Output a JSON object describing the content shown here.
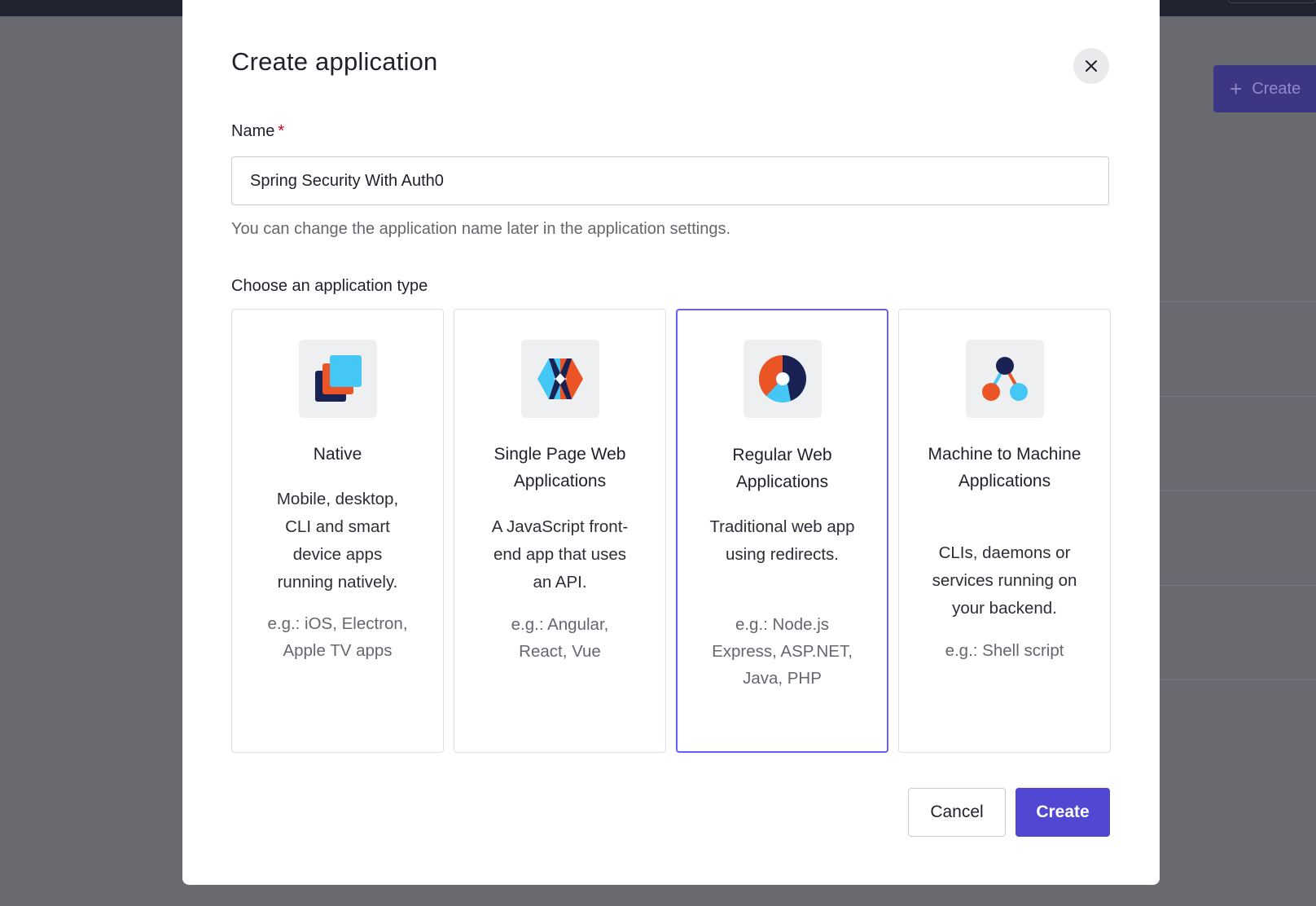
{
  "background": {
    "create_button_label": "Create"
  },
  "modal": {
    "title": "Create application",
    "name_label": "Name",
    "required_mark": "*",
    "name_value": "Spring Security With Auth0",
    "name_hint": "You can change the application name later in the application settings.",
    "type_label": "Choose an application type",
    "cancel_label": "Cancel",
    "create_label": "Create"
  },
  "app_types": [
    {
      "title": "Native",
      "description": "Mobile, desktop, CLI and smart device apps running natively.",
      "example": "e.g.: iOS, Electron, Apple TV apps",
      "icon": "native-app-icon",
      "selected": false
    },
    {
      "title": "Single Page Web Applications",
      "description": "A JavaScript front-end app that uses an API.",
      "example": "e.g.: Angular, React, Vue",
      "icon": "spa-icon",
      "selected": false
    },
    {
      "title": "Regular Web Applications",
      "description": "Traditional web app using redirects.",
      "example": "e.g.: Node.js Express, ASP.NET, Java, PHP",
      "icon": "regular-web-app-icon",
      "selected": true
    },
    {
      "title": "Machine to Machine Applications",
      "description": "CLIs, daemons or services running on your backend.",
      "example": "e.g.: Shell script",
      "icon": "machine-to-machine-icon",
      "selected": false
    }
  ],
  "colors": {
    "accent": "#635dff",
    "primary_button": "#5048d3",
    "overlay": "#6a6b70",
    "required": "#d0021b"
  }
}
